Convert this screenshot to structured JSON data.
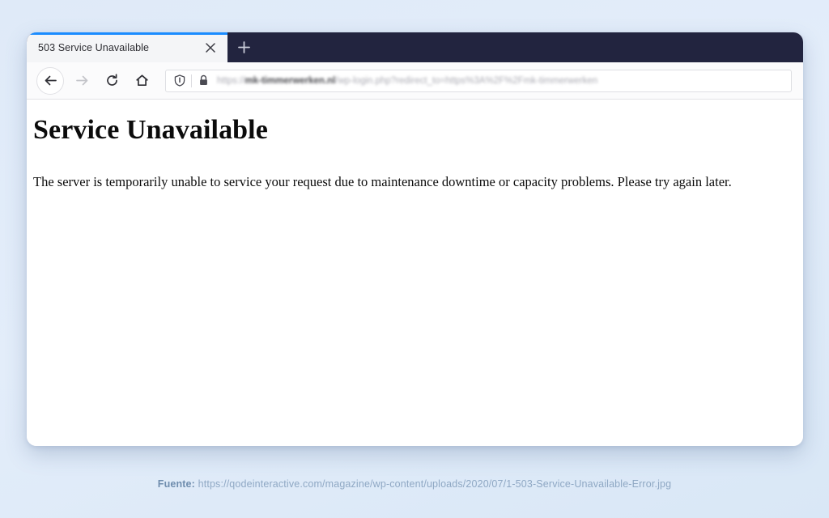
{
  "browser": {
    "tab": {
      "title": "503 Service Unavailable",
      "close_icon": "close-icon",
      "accent_color": "#1a8cff"
    },
    "new_tab_button": {
      "label": "+",
      "icon": "plus-icon"
    },
    "toolbar": {
      "back_icon": "arrow-left-icon",
      "forward_icon": "arrow-right-icon",
      "reload_icon": "reload-icon",
      "home_icon": "home-icon"
    },
    "urlbar": {
      "shield_icon": "shield-icon",
      "lock_icon": "lock-icon",
      "url_prefix": "https://",
      "url_host": "mk-timmerwerken.nl",
      "url_path": "/wp-login.php?redirect_to=https%3A%2F%2Fmk-timmerwerken",
      "titlebar_color": "#22243f"
    }
  },
  "page": {
    "heading": "Service Unavailable",
    "body": "The server is temporarily unable to service your request due to maintenance downtime or capacity problems. Please try again later."
  },
  "caption": {
    "label": "Fuente:",
    "url": "https://qodeinteractive.com/magazine/wp-content/uploads/2020/07/1-503-Service-Unavailable-Error.jpg"
  }
}
